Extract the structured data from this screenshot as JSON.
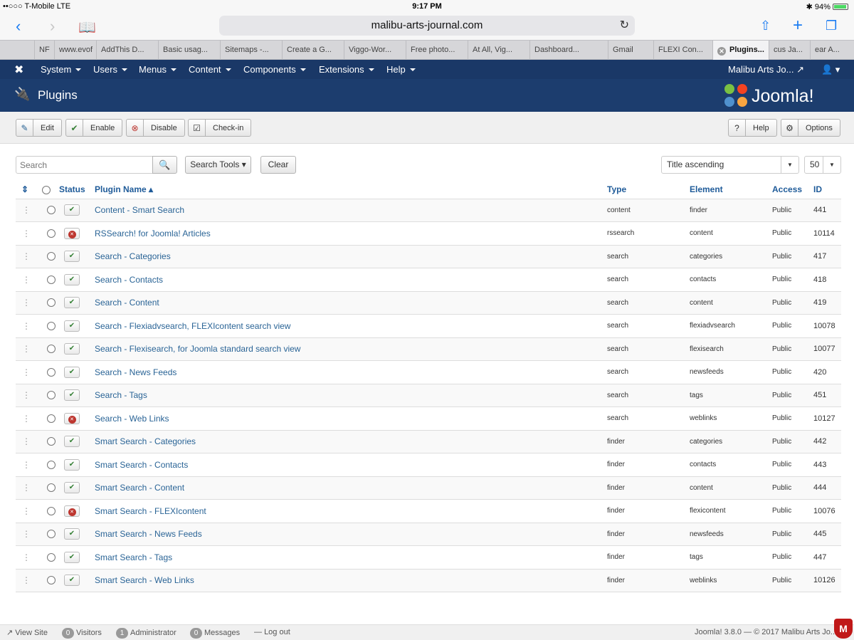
{
  "status_bar": {
    "carrier": "••○○○ T-Mobile  LTE",
    "time": "9:17 PM",
    "battery": "94%"
  },
  "safari": {
    "url": "malibu-arts-journal.com"
  },
  "tabs": [
    "NF",
    "www.evof",
    "AddThis D...",
    "Basic usag...",
    "Sitemaps -...",
    "Create a G...",
    "Viggo-Wor...",
    "Free photo...",
    "At All, Vig...",
    "Dashboard...",
    "Gmail",
    "FLEXI Con...",
    "Plugins...",
    "cus Ja...",
    "ear A..."
  ],
  "nav": {
    "items": [
      "System",
      "Users",
      "Menus",
      "Content",
      "Components",
      "Extensions",
      "Help"
    ],
    "site": "Malibu Arts Jo...",
    "user_icon": "user-icon"
  },
  "header": {
    "title": "Plugins",
    "brand": "Joomla!"
  },
  "toolbar": {
    "edit": "Edit",
    "enable": "Enable",
    "disable": "Disable",
    "checkin": "Check-in",
    "help": "Help",
    "options": "Options"
  },
  "filters": {
    "search_placeholder": "Search",
    "search_tools": "Search Tools",
    "clear": "Clear",
    "ordering": "Title ascending",
    "limit": "50"
  },
  "columns": {
    "status": "Status",
    "name": "Plugin Name",
    "type": "Type",
    "element": "Element",
    "access": "Access",
    "id": "ID"
  },
  "rows": [
    {
      "enabled": true,
      "name": "Content - Smart Search",
      "type": "content",
      "element": "finder",
      "access": "Public",
      "id": "441"
    },
    {
      "enabled": false,
      "name": "RSSearch! for Joomla! Articles",
      "type": "rssearch",
      "element": "content",
      "access": "Public",
      "id": "10114"
    },
    {
      "enabled": true,
      "name": "Search - Categories",
      "type": "search",
      "element": "categories",
      "access": "Public",
      "id": "417"
    },
    {
      "enabled": true,
      "name": "Search - Contacts",
      "type": "search",
      "element": "contacts",
      "access": "Public",
      "id": "418"
    },
    {
      "enabled": true,
      "name": "Search - Content",
      "type": "search",
      "element": "content",
      "access": "Public",
      "id": "419"
    },
    {
      "enabled": true,
      "name": "Search - Flexiadvsearch, FLEXIcontent search view",
      "type": "search",
      "element": "flexiadvsearch",
      "access": "Public",
      "id": "10078"
    },
    {
      "enabled": true,
      "name": "Search - Flexisearch, for Joomla standard search view",
      "type": "search",
      "element": "flexisearch",
      "access": "Public",
      "id": "10077"
    },
    {
      "enabled": true,
      "name": "Search - News Feeds",
      "type": "search",
      "element": "newsfeeds",
      "access": "Public",
      "id": "420"
    },
    {
      "enabled": true,
      "name": "Search - Tags",
      "type": "search",
      "element": "tags",
      "access": "Public",
      "id": "451"
    },
    {
      "enabled": false,
      "name": "Search - Web Links",
      "type": "search",
      "element": "weblinks",
      "access": "Public",
      "id": "10127"
    },
    {
      "enabled": true,
      "name": "Smart Search - Categories",
      "type": "finder",
      "element": "categories",
      "access": "Public",
      "id": "442"
    },
    {
      "enabled": true,
      "name": "Smart Search - Contacts",
      "type": "finder",
      "element": "contacts",
      "access": "Public",
      "id": "443"
    },
    {
      "enabled": true,
      "name": "Smart Search - Content",
      "type": "finder",
      "element": "content",
      "access": "Public",
      "id": "444"
    },
    {
      "enabled": false,
      "name": "Smart Search - FLEXIcontent",
      "type": "finder",
      "element": "flexicontent",
      "access": "Public",
      "id": "10076"
    },
    {
      "enabled": true,
      "name": "Smart Search - News Feeds",
      "type": "finder",
      "element": "newsfeeds",
      "access": "Public",
      "id": "445"
    },
    {
      "enabled": true,
      "name": "Smart Search - Tags",
      "type": "finder",
      "element": "tags",
      "access": "Public",
      "id": "447"
    },
    {
      "enabled": true,
      "name": "Smart Search - Web Links",
      "type": "finder",
      "element": "weblinks",
      "access": "Public",
      "id": "10126"
    }
  ],
  "footer": {
    "view_site": "View Site",
    "visitors_count": "0",
    "visitors": "Visitors",
    "admin_count": "1",
    "admin": "Administrator",
    "messages_count": "0",
    "messages": "Messages",
    "logout": "Log out",
    "copyright": "Joomla! 3.8.0  —  © 2017 Malibu Arts Jo..."
  },
  "colors": {
    "nav_bg": "#1a3867",
    "header_bg": "#1c3d6e",
    "link": "#2a6496",
    "enabled": "#378137",
    "disabled": "#bd362f"
  }
}
